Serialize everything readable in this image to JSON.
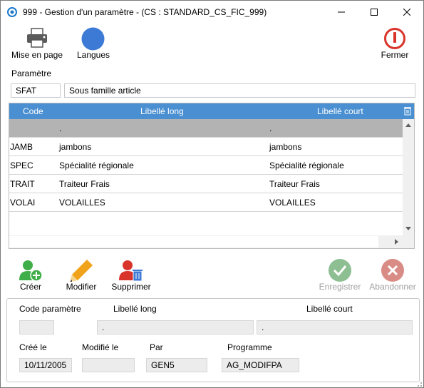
{
  "window": {
    "title": "999 - Gestion d'un paramètre - (CS : STANDARD_CS_FIC_999)"
  },
  "toolbar": {
    "print_label": "Mise en page",
    "languages_label": "Langues",
    "close_label": "Fermer"
  },
  "parametre": {
    "section_label": "Paramètre",
    "code": "SFAT",
    "libelle": "Sous famille article"
  },
  "grid": {
    "columns": [
      "Code",
      "Libellé long",
      "Libellé court"
    ],
    "selected_row": {
      "code": "",
      "long": ".",
      "short": "."
    },
    "rows": [
      {
        "code": "JAMB",
        "long": "jambons",
        "short": "jambons"
      },
      {
        "code": "SPEC",
        "long": "Spécialité régionale",
        "short": "Spécialité régionale"
      },
      {
        "code": "TRAIT",
        "long": "Traiteur Frais",
        "short": "Traiteur Frais"
      },
      {
        "code": "VOLAI",
        "long": "VOLAILLES",
        "short": "VOLAILLES"
      }
    ]
  },
  "actions": {
    "create_label": "Créer",
    "modify_label": "Modifier",
    "delete_label": "Supprimer",
    "save_label": "Enregistrer",
    "cancel_label": "Abandonner"
  },
  "detail": {
    "code_label": "Code paramètre",
    "long_label": "Libellé long",
    "short_label": "Libellé court",
    "code_value": "",
    "long_value": ".",
    "short_value": ".",
    "created_label": "Créé le",
    "modified_label": "Modifié le",
    "by_label": "Par",
    "program_label": "Programme",
    "created_value": "10/11/2005",
    "modified_value": "",
    "by_value": "GEN5",
    "program_value": "AG_MODIFPA"
  },
  "colors": {
    "grid_header": "#4a8fd1",
    "selected_row": "#b3b3b3",
    "close_red": "#d9342b",
    "create_green": "#3fae49",
    "edit_orange": "#f0a21a",
    "delete_red": "#d9342b",
    "disabled_gray": "#a0a0a0"
  }
}
